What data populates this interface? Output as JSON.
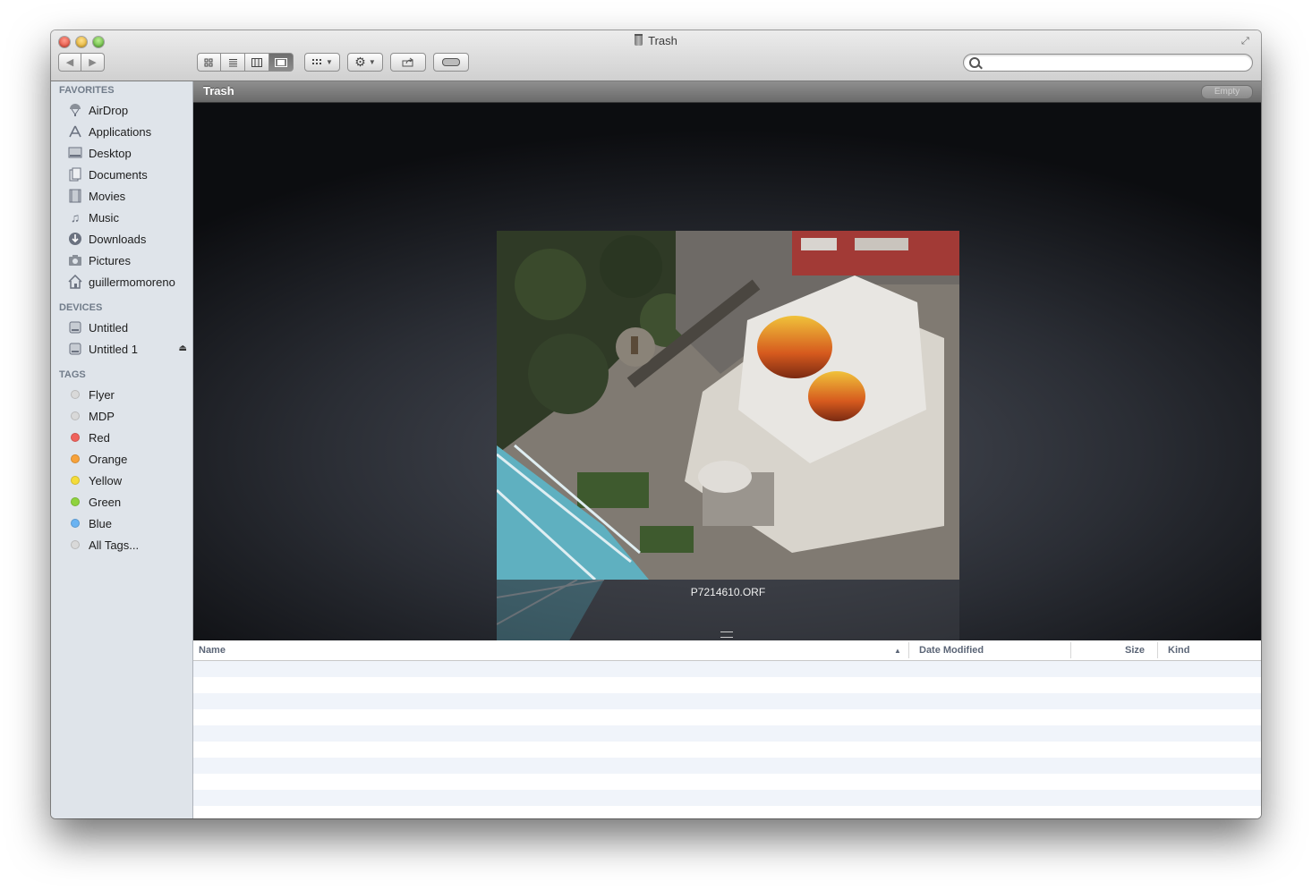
{
  "window": {
    "title": "Trash"
  },
  "toolbar": {
    "back_label": "◀",
    "forward_label": "▶",
    "view_icons": [
      "icon-view-icon",
      "list-view-icon",
      "column-view-icon",
      "coverflow-view-icon"
    ],
    "active_view": "coverflow",
    "search_placeholder": ""
  },
  "sidebar": {
    "favorites_heading": "FAVORITES",
    "favorites": [
      {
        "label": "AirDrop",
        "icon": "airdrop-icon"
      },
      {
        "label": "Applications",
        "icon": "applications-icon"
      },
      {
        "label": "Desktop",
        "icon": "desktop-icon"
      },
      {
        "label": "Documents",
        "icon": "documents-icon"
      },
      {
        "label": "Movies",
        "icon": "movies-icon"
      },
      {
        "label": "Music",
        "icon": "music-icon"
      },
      {
        "label": "Downloads",
        "icon": "downloads-icon"
      },
      {
        "label": "Pictures",
        "icon": "pictures-icon"
      },
      {
        "label": "guillermomoreno",
        "icon": "home-icon"
      }
    ],
    "devices_heading": "DEVICES",
    "devices": [
      {
        "label": "Untitled",
        "icon": "disk-icon"
      },
      {
        "label": "Untitled 1",
        "icon": "disk-icon",
        "ejectable": true
      }
    ],
    "tags_heading": "TAGS",
    "tags": [
      {
        "label": "Flyer",
        "color": "#d9d9d9"
      },
      {
        "label": "MDP",
        "color": "#d9d9d9"
      },
      {
        "label": "Red",
        "color": "#f0625c"
      },
      {
        "label": "Orange",
        "color": "#f7a23a"
      },
      {
        "label": "Yellow",
        "color": "#f4dc3a"
      },
      {
        "label": "Green",
        "color": "#8fd33e"
      },
      {
        "label": "Blue",
        "color": "#6ab3f2"
      },
      {
        "label": "All Tags...",
        "color": "#d9d9d9"
      }
    ]
  },
  "pathbar": {
    "title": "Trash",
    "empty_label": "Empty"
  },
  "coverflow": {
    "file_name": "P7214610.ORF"
  },
  "list": {
    "columns": [
      "Name",
      "Date Modified",
      "Size",
      "Kind"
    ],
    "sort_column": "Name",
    "sort_direction": "ascending"
  },
  "colors": {
    "sidebar_bg": "#dfe4ea",
    "pathbar": "#7a7a7a",
    "accent_heading": "#717c8a"
  }
}
